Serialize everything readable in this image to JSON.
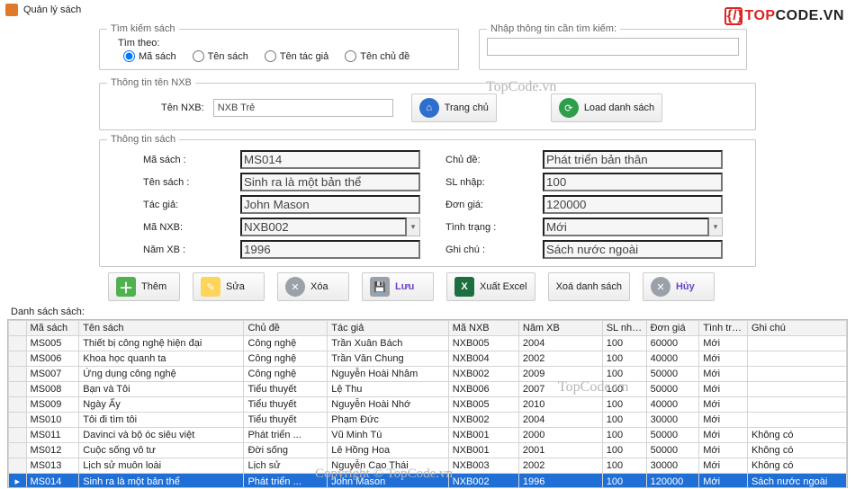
{
  "window": {
    "title": "Quản lý sách"
  },
  "logo": {
    "text1": "TOP",
    "text2": "CODE",
    "suffix": ".VN"
  },
  "search": {
    "legend": "Tìm kiếm sách",
    "by_label": "Tìm theo:",
    "options": {
      "ma_sach": "Mã sách",
      "ten_sach": "Tên sách",
      "tac_gia": "Tên tác giả",
      "chu_de": "Tên chủ đề"
    },
    "input_label": "Nhập thông tin cần tìm kiếm:",
    "value": ""
  },
  "nxb": {
    "legend": "Thông tin tên NXB",
    "label": "Tên NXB:",
    "value": "NXB Trẻ",
    "home_btn": "Trang chủ",
    "load_btn": "Load danh sách"
  },
  "book": {
    "legend": "Thông tin sách",
    "labels": {
      "ma": "Mã sách :",
      "ten": "Tên sách :",
      "tacgia": "Tác giả:",
      "manxb": "Mã NXB:",
      "nam": "Năm XB :",
      "chude": "Chủ đề:",
      "sl": "SL nhập:",
      "dongia": "Đơn giá:",
      "tinhtrang": "Tình trạng :",
      "ghichu": "Ghi chú :"
    },
    "values": {
      "ma": "MS014",
      "ten": "Sinh ra là một bản thể",
      "tacgia": "John Mason",
      "manxb": "NXB002",
      "nam": "1996",
      "chude": "Phát triển bản thân",
      "sl": "100",
      "dongia": "120000",
      "tinhtrang": "Mới",
      "ghichu": "Sách nước ngoài"
    }
  },
  "toolbar": {
    "them": "Thêm",
    "sua": "Sửa",
    "xoa": "Xóa",
    "luu": "Lưu",
    "excel": "Xuất Excel",
    "xoads": "Xoá danh sách",
    "huy": "Hủy"
  },
  "list": {
    "label": "Danh sách sách:",
    "columns": [
      "Mã sách",
      "Tên sách",
      "Chủ đề",
      "Tác giả",
      "Mã NXB",
      "Năm XB",
      "SL nhập",
      "Đơn giá",
      "Tình trạng",
      "Ghi chú"
    ],
    "rows": [
      [
        "MS005",
        "Thiết bị công nghệ hiện đại",
        "Công nghệ",
        "Trần Xuân Bách",
        "NXB005",
        "2004",
        "100",
        "60000",
        "Mới",
        ""
      ],
      [
        "MS006",
        "Khoa học quanh ta",
        "Công nghệ",
        "Trần Văn Chung",
        "NXB004",
        "2002",
        "100",
        "40000",
        "Mới",
        ""
      ],
      [
        "MS007",
        "Ứng dụng công nghệ",
        "Công nghệ",
        "Nguyễn Hoài Nhâm",
        "NXB002",
        "2009",
        "100",
        "50000",
        "Mới",
        ""
      ],
      [
        "MS008",
        "Bạn và Tôi",
        "Tiểu thuyết",
        "Lệ Thu",
        "NXB006",
        "2007",
        "100",
        "50000",
        "Mới",
        ""
      ],
      [
        "MS009",
        "Ngày Ấy",
        "Tiểu thuyết",
        "Nguyễn Hoài Nhớ",
        "NXB005",
        "2010",
        "100",
        "40000",
        "Mới",
        ""
      ],
      [
        "MS010",
        "Tôi đi tìm tôi",
        "Tiểu thuyết",
        "Phạm Đức",
        "NXB002",
        "2004",
        "100",
        "30000",
        "Mới",
        ""
      ],
      [
        "MS011",
        "Davinci và bộ óc siêu việt",
        "Phát triển ...",
        "Vũ Minh Tú",
        "NXB001",
        "2000",
        "100",
        "50000",
        "Mới",
        "Không có"
      ],
      [
        "MS012",
        "Cuộc sống vô tư",
        "Đời sống",
        "Lê Hồng Hoa",
        "NXB001",
        "2001",
        "100",
        "50000",
        "Mới",
        "Không có"
      ],
      [
        "MS013",
        "Lịch sử muôn loài",
        "Lịch sử",
        "Nguyễn Cao Thái",
        "NXB003",
        "2002",
        "100",
        "30000",
        "Mới",
        "Không có"
      ],
      [
        "MS014",
        "Sinh ra là một bản thể",
        "Phát triển ...",
        "John Mason",
        "NXB002",
        "1996",
        "100",
        "120000",
        "Mới",
        "Sách nước ngoài"
      ]
    ],
    "selected": "MS014"
  },
  "watermarks": {
    "a": "TopCode.vn",
    "b": "TopCode.vn",
    "c": "Copyright © TopCode.vn"
  }
}
